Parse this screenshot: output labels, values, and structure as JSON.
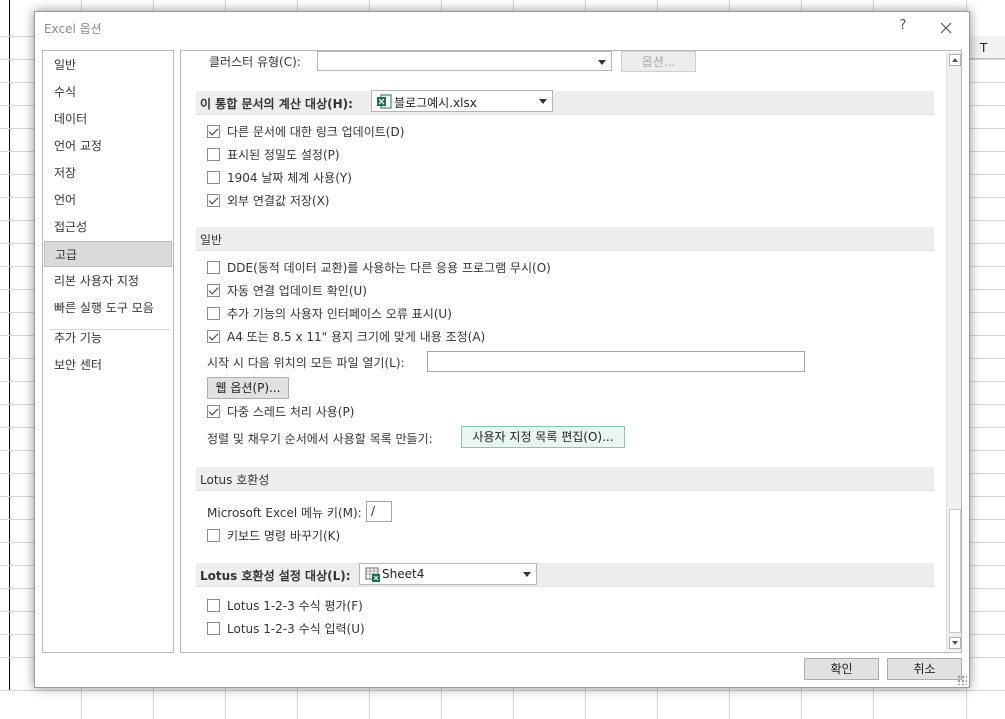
{
  "background": {
    "column_header_letter": "T"
  },
  "dialog": {
    "title": "Excel 옵션",
    "help_label": "?",
    "ok_label": "확인",
    "cancel_label": "취소"
  },
  "nav": {
    "items": [
      {
        "label": "일반"
      },
      {
        "label": "수식"
      },
      {
        "label": "데이터"
      },
      {
        "label": "언어 교정"
      },
      {
        "label": "저장"
      },
      {
        "label": "언어"
      },
      {
        "label": "접근성"
      },
      {
        "label": "고급",
        "selected": true
      },
      {
        "label": "리본 사용자 지정"
      },
      {
        "label": "빠른 실행 도구 모음"
      },
      {
        "label": "추가 기능"
      },
      {
        "label": "보안 센터"
      }
    ]
  },
  "content": {
    "cluster_type_label": "클러스터 유형(C):",
    "cluster_type_value": "",
    "options_button": "옵션...",
    "workbook_section": {
      "title": "이 통합 문서의 계산 대상(H):",
      "combo_value": "블로그예시.xlsx",
      "checkboxes": [
        {
          "label": "다른 문서에 대한 링크 업데이트(D)",
          "checked": true
        },
        {
          "label": "표시된 정밀도 설정(P)",
          "checked": false
        },
        {
          "label": "1904 날짜 체계 사용(Y)",
          "checked": false
        },
        {
          "label": "외부 연결값 저장(X)",
          "checked": true
        }
      ]
    },
    "general_section": {
      "title": "일반",
      "checkboxes": [
        {
          "label": "DDE(동적 데이터 교환)를 사용하는 다른 응용 프로그램 무시(O)",
          "checked": false
        },
        {
          "label": "자동 연결 업데이트 확인(U)",
          "checked": true
        },
        {
          "label": "추가 기능의 사용자 인터페이스 오류 표시(U)",
          "checked": false
        },
        {
          "label": "A4 또는 8.5 x 11\" 용지 크기에 맞게 내용 조정(A)",
          "checked": true
        }
      ],
      "startup_label": "시작 시 다음 위치의 모든 파일 열기(L):",
      "startup_value": "",
      "web_options_button": "웹 옵션(P)...",
      "multithread_label": "다중 스레드 처리 사용(P)",
      "multithread_checked": true,
      "custom_list_label": "정렬 및 채우기 순서에서 사용할 목록 만들기:",
      "custom_list_button": "사용자 지정 목록 편집(O)..."
    },
    "lotus_section": {
      "title": "Lotus 호환성",
      "menu_key_label": "Microsoft Excel 메뉴 키(M):",
      "menu_key_value": "/",
      "keyboard_label": "키보드 명령 바꾸기(K)",
      "keyboard_checked": false
    },
    "lotus_settings_section": {
      "title": "Lotus 호환성 설정 대상(L):",
      "combo_value": "Sheet4",
      "checkboxes": [
        {
          "label": "Lotus 1-2-3 수식 평가(F)",
          "checked": false
        },
        {
          "label": "Lotus 1-2-3 수식 입력(U)",
          "checked": false
        }
      ]
    }
  },
  "icons": {
    "close": "close-icon",
    "excel_file": "excel-file-icon",
    "sheet": "sheet-icon",
    "dropdown": "chevron-down-icon"
  },
  "colors": {
    "selected_nav": "#dadada",
    "section_header": "#eeeeee",
    "accent_button": "#e9f5ef",
    "excel_green": "#1d7044"
  }
}
